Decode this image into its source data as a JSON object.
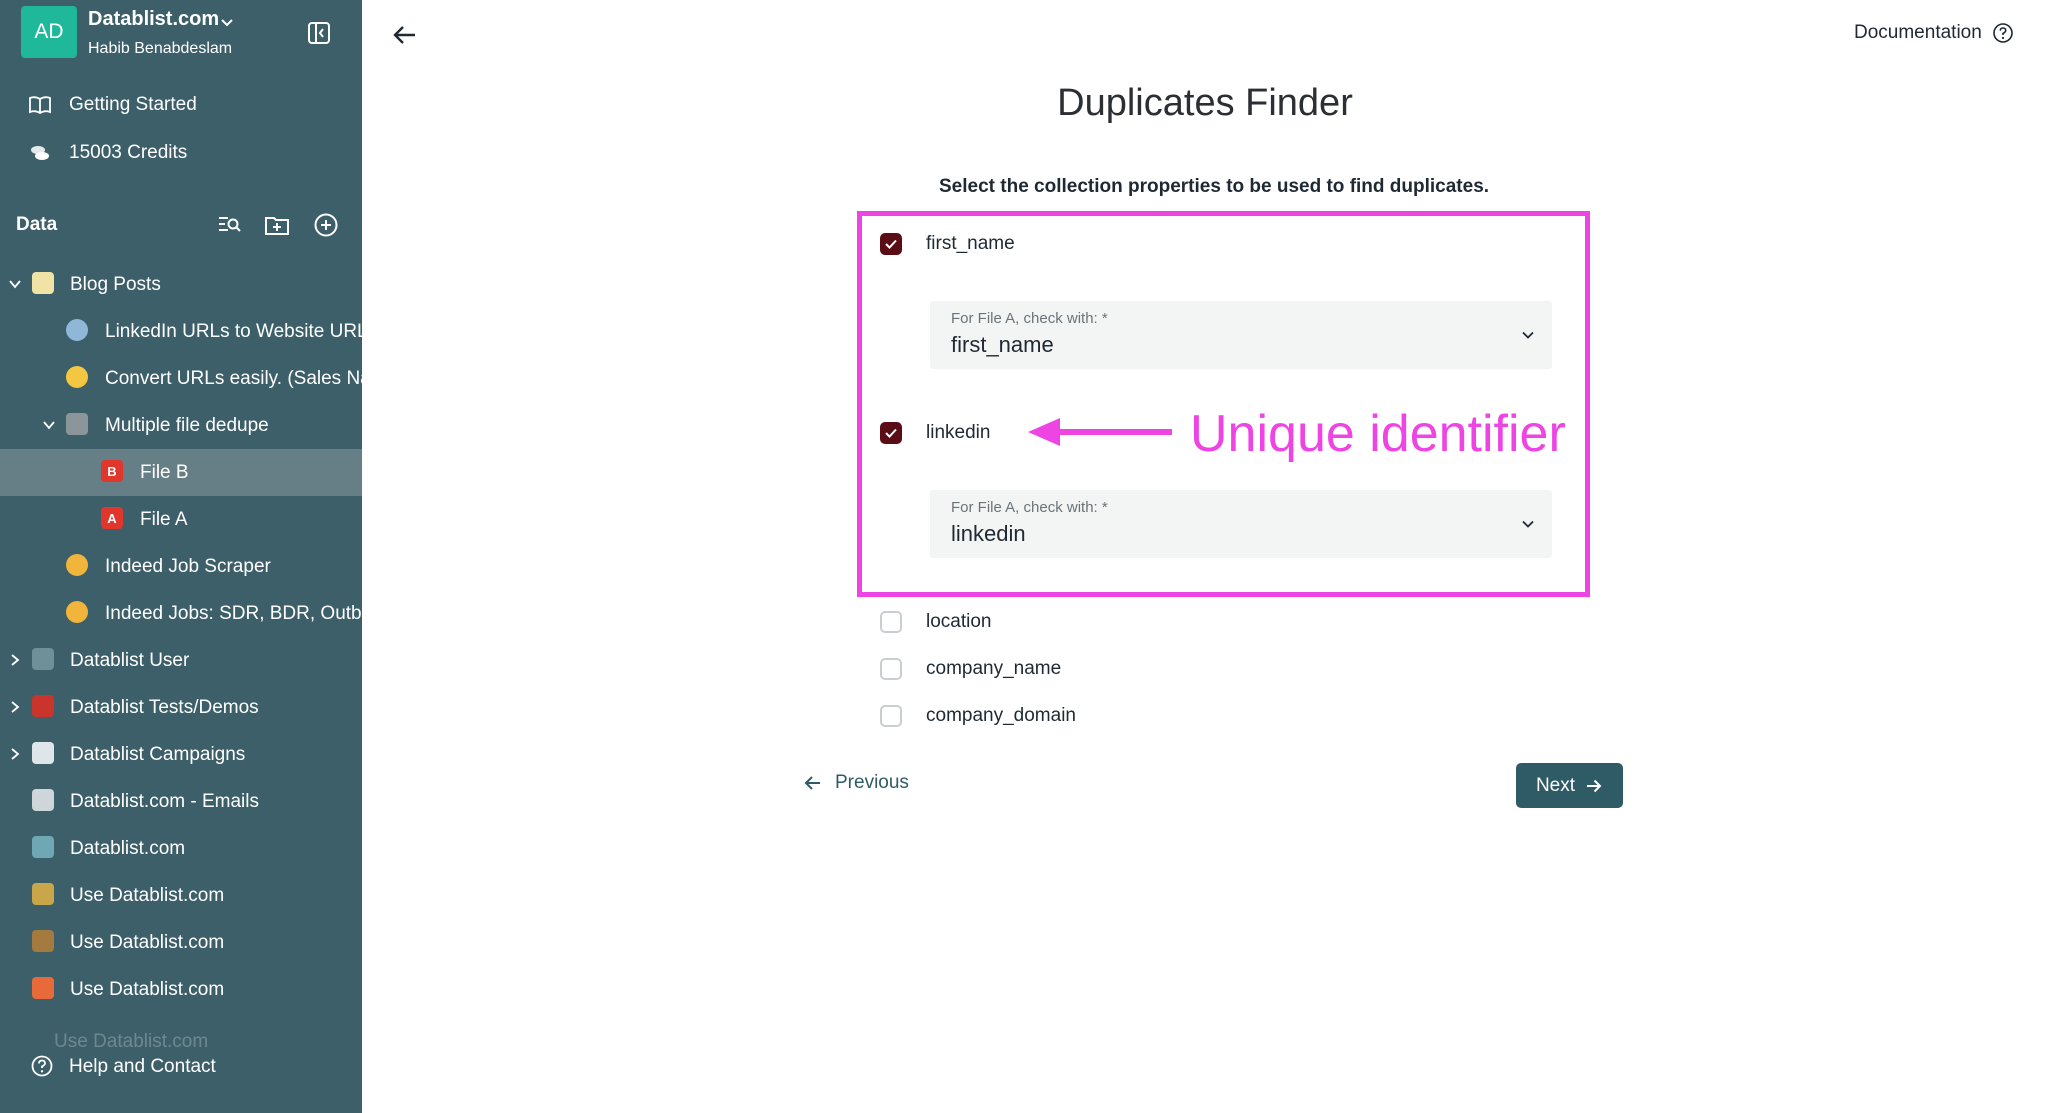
{
  "workspace": {
    "initials": "AD",
    "name": "Datablist.com",
    "user": "Habib Benabdeslam"
  },
  "nav": {
    "getting_started": "Getting Started",
    "credits": "15003 Credits",
    "data_heading": "Data",
    "help": "Help and Contact"
  },
  "tree": [
    {
      "label": "Blog Posts"
    },
    {
      "label": "LinkedIn URLs to Website URLs"
    },
    {
      "label": "Convert URLs easily. (Sales Navigator)"
    },
    {
      "label": "Multiple file dedupe"
    },
    {
      "label": "File B",
      "badge": "B"
    },
    {
      "label": "File A",
      "badge": "A"
    },
    {
      "label": "Indeed Job Scraper"
    },
    {
      "label": "Indeed Jobs: SDR, BDR, Outbound"
    },
    {
      "label": "Datablist User"
    },
    {
      "label": "Datablist Tests/Demos"
    },
    {
      "label": "Datablist Campaigns"
    },
    {
      "label": "Datablist.com - Emails"
    },
    {
      "label": "Datablist.com"
    },
    {
      "label": "Use Datablist.com"
    },
    {
      "label": "Use Datablist.com"
    },
    {
      "label": "Use Datablist.com"
    },
    {
      "label": "Use Datablist.com"
    }
  ],
  "header": {
    "documentation": "Documentation"
  },
  "main": {
    "title": "Duplicates Finder",
    "instructions": "Select the collection properties to be used to find duplicates.",
    "properties": [
      {
        "label": "first_name",
        "checked": true,
        "select_label": "For File A, check with: *",
        "select_value": "first_name"
      },
      {
        "label": "linkedin",
        "checked": true,
        "select_label": "For File A, check with: *",
        "select_value": "linkedin"
      },
      {
        "label": "location",
        "checked": false
      },
      {
        "label": "company_name",
        "checked": false
      },
      {
        "label": "company_domain",
        "checked": false
      }
    ],
    "annotation": "Unique identifier",
    "previous": "Previous",
    "next": "Next"
  },
  "colors": {
    "sidebar": "#3d5f6a",
    "accent": "#2f5b66",
    "checkbox": "#5a0d15",
    "annotation": "#ee44e4"
  }
}
